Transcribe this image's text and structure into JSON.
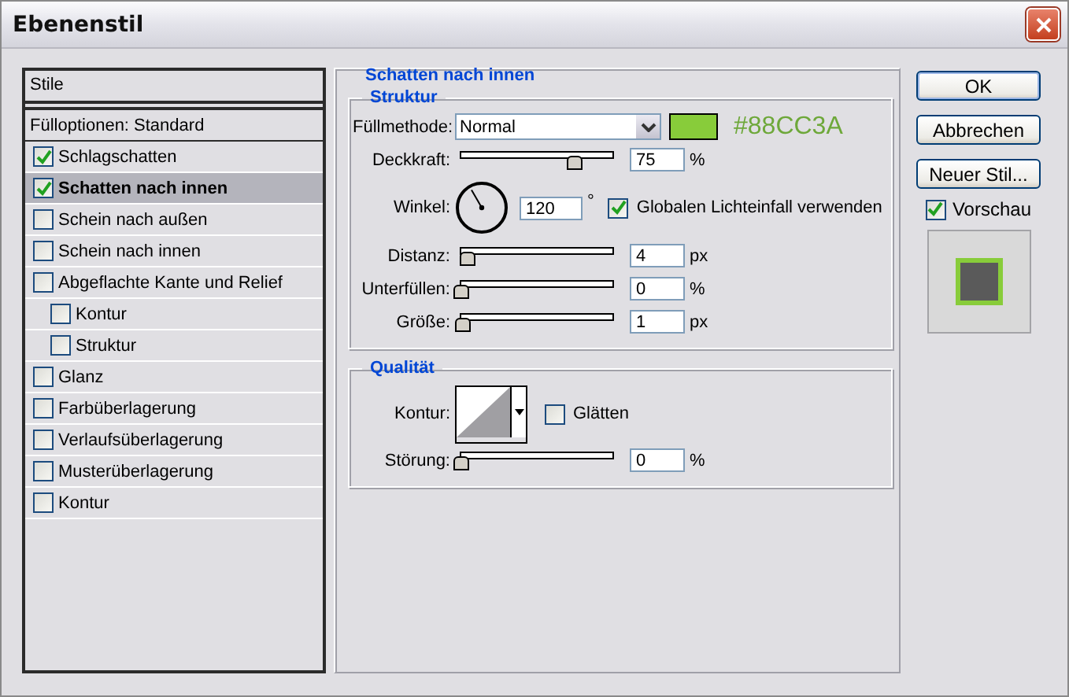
{
  "window": {
    "title": "Ebenenstil"
  },
  "styles_list": {
    "header": "Stile",
    "blending_options": {
      "label": "Fülloptionen: Standard",
      "selected": false
    },
    "effects": [
      {
        "label": "Schlagschatten",
        "checked": true,
        "selected": false
      },
      {
        "label": "Schatten nach innen",
        "checked": true,
        "selected": true
      },
      {
        "label": "Schein nach außen",
        "checked": false,
        "selected": false
      },
      {
        "label": "Schein nach innen",
        "checked": false,
        "selected": false
      },
      {
        "label": "Abgeflachte Kante und Relief",
        "checked": false,
        "selected": false,
        "children": [
          {
            "label": "Kontur",
            "checked": false,
            "selected": false
          },
          {
            "label": "Struktur",
            "checked": false,
            "selected": false
          }
        ]
      },
      {
        "label": "Glanz",
        "checked": false,
        "selected": false
      },
      {
        "label": "Farbüberlagerung",
        "checked": false,
        "selected": false
      },
      {
        "label": "Verlaufsüberlagerung",
        "checked": false,
        "selected": false
      },
      {
        "label": "Musterüberlagerung",
        "checked": false,
        "selected": false
      },
      {
        "label": "Kontur",
        "checked": false,
        "selected": false
      }
    ]
  },
  "panel": {
    "title": "Schatten nach innen",
    "structure": {
      "title": "Struktur",
      "blend_mode": {
        "label": "Füllmethode:",
        "value": "Normal"
      },
      "color": "#88cc3a",
      "color_code": "#88CC3A",
      "rows": [
        {
          "kind": "slider",
          "label": "Deckkraft:",
          "level": 0.75,
          "value": "75",
          "unit": "%"
        },
        {
          "kind": "angle",
          "label": "Winkel:",
          "value": "120",
          "unit": "°",
          "global_light": {
            "label": "Globalen Lichteinfall verwenden",
            "checked": true
          }
        },
        {
          "kind": "slider",
          "label": "Distanz:",
          "level": 0.04,
          "value": "4",
          "unit": "px"
        },
        {
          "kind": "slider",
          "label": "Unterfüllen:",
          "level": 0,
          "value": "0",
          "unit": "%"
        },
        {
          "kind": "slider",
          "label": "Größe:",
          "level": 0.01,
          "value": "1",
          "unit": "px"
        }
      ]
    },
    "quality": {
      "title": "Qualität",
      "contour": {
        "label": "Kontur:"
      },
      "antialias": {
        "label": "Glätten",
        "checked": false
      },
      "noise": {
        "kind": "slider",
        "label": "Störung:",
        "level": 0,
        "value": "0",
        "unit": "%"
      }
    }
  },
  "buttons": [
    {
      "label": "OK",
      "default": true
    },
    {
      "label": "Abbrechen",
      "default": false
    },
    {
      "label": "Neuer Stil...",
      "default": false
    }
  ],
  "preview": {
    "label": "Vorschau",
    "checked": true
  }
}
